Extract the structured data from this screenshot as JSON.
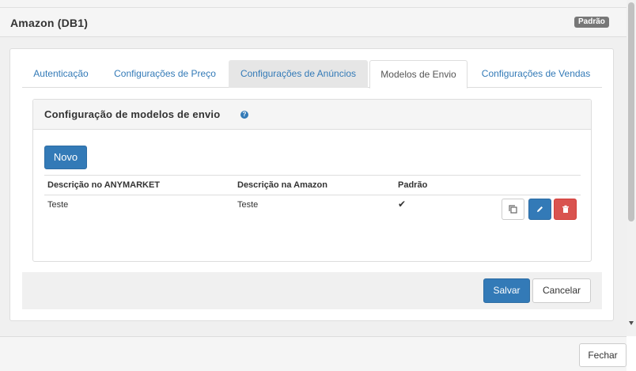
{
  "modal": {
    "title": "Amazon (DB1)",
    "badge": "Padrão"
  },
  "tabs": [
    {
      "label": "Autenticação"
    },
    {
      "label": "Configurações de Preço"
    },
    {
      "label": "Configurações de Anúncios"
    },
    {
      "label": "Modelos de Envio"
    },
    {
      "label": "Configurações de Vendas"
    }
  ],
  "section": {
    "title": "Configuração de modelos de envio",
    "help_icon": "question-circle-icon",
    "new_button": "Novo"
  },
  "table": {
    "headers": [
      "Descrição no ANYMARKET",
      "Descrição na Amazon",
      "Padrão"
    ],
    "rows": [
      {
        "anymarket": "Teste",
        "amazon": "Teste",
        "default_icon": "check-icon"
      }
    ]
  },
  "actions": {
    "save": "Salvar",
    "cancel": "Cancelar",
    "close": "Fechar"
  },
  "colors": {
    "primary": "#337ab7",
    "danger": "#d9534f",
    "badge": "#777777"
  }
}
